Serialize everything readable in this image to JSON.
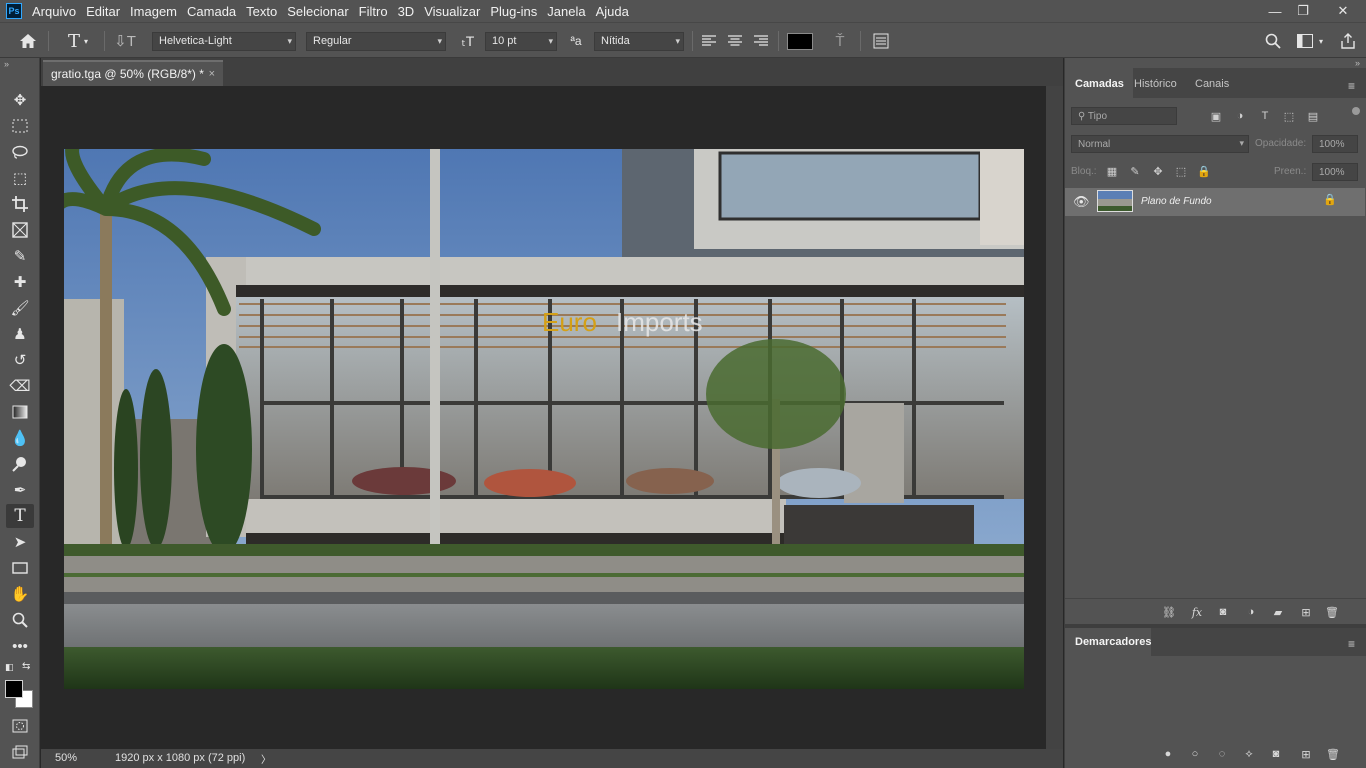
{
  "app": {
    "logo": "Ps"
  },
  "menu": [
    "Arquivo",
    "Editar",
    "Imagem",
    "Camada",
    "Texto",
    "Selecionar",
    "Filtro",
    "3D",
    "Visualizar",
    "Plug-ins",
    "Janela",
    "Ajuda"
  ],
  "window": {
    "minimize": "—",
    "restore": "❐",
    "close": "✕"
  },
  "options": {
    "font_family": "Helvetica-Light",
    "font_style": "Regular",
    "font_size": "10 pt",
    "aa_icon": "ªa",
    "antialias": "Nítida",
    "text_color": "#000000"
  },
  "document": {
    "tab_title": "gratio.tga @ 50% (RGB/8*) *",
    "close": "×"
  },
  "status": {
    "zoom": "50%",
    "info": "1920 px x 1080 px (72 ppi)",
    "arrow": "〉"
  },
  "image": {
    "sign_part1": "Euro",
    "sign_part2": "Imports"
  },
  "panels": {
    "tabs": [
      "Camadas",
      "Histórico",
      "Canais"
    ],
    "search_placeholder": "Tipo",
    "blend_mode": "Normal",
    "opacity_label": "Opacidade:",
    "opacity_value": "100%",
    "lock_label": "Bloq.:",
    "fill_label": "Preen.:",
    "fill_value": "100%",
    "layer_name": "Plano de Fundo",
    "bookmarks_tab": "Demarcadores"
  },
  "colors": {
    "foreground": "#000000",
    "background": "#ffffff",
    "accent": "#31a8ff",
    "sign_gold": "#d4a017"
  },
  "icons": {
    "tools": [
      "move-icon",
      "marquee-icon",
      "lasso-icon",
      "object-select-icon",
      "crop-icon",
      "frame-icon",
      "eyedropper-icon",
      "healing-icon",
      "brush-icon",
      "stamp-icon",
      "history-brush-icon",
      "eraser-icon",
      "gradient-icon",
      "blur-icon",
      "dodge-icon",
      "pen-icon",
      "type-icon",
      "path-select-icon",
      "rectangle-icon",
      "hand-icon",
      "zoom-icon",
      "more-tools-icon"
    ]
  }
}
